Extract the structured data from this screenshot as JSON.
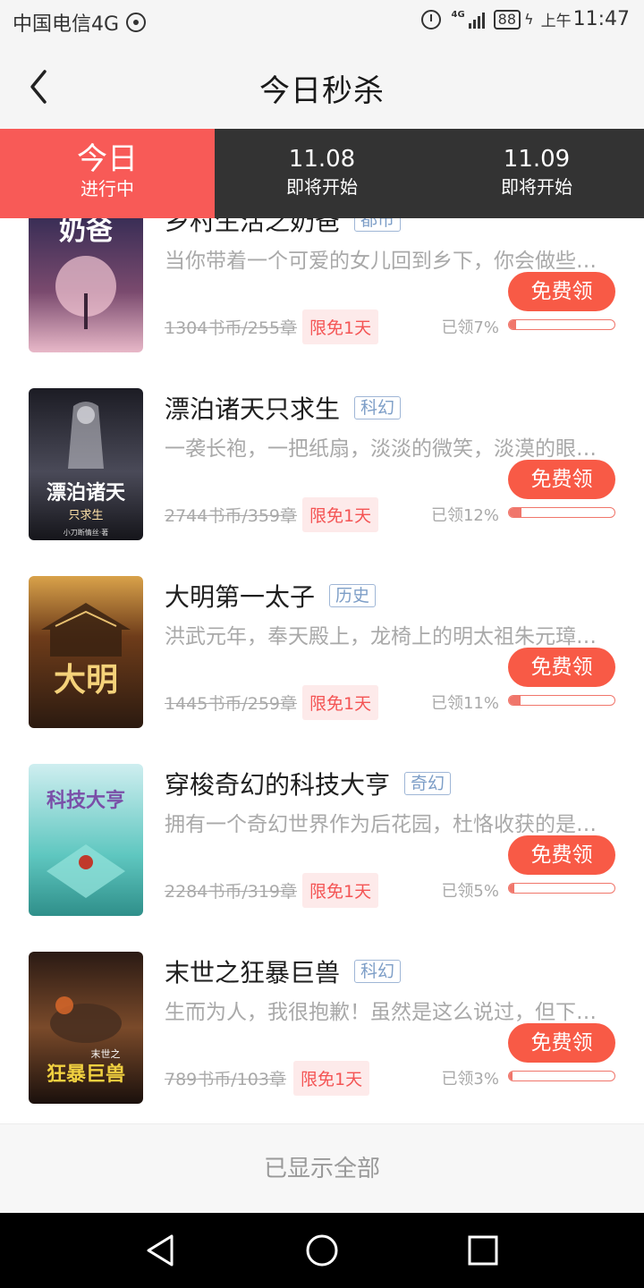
{
  "status_bar": {
    "carrier": "中国电信4G",
    "network": "4G",
    "battery": "88",
    "ampm": "上午",
    "time": "11:47"
  },
  "header": {
    "title": "今日秒杀"
  },
  "tabs": [
    {
      "title": "今日",
      "subtitle": "进行中",
      "active": true
    },
    {
      "title": "11.08",
      "subtitle": "即将开始",
      "active": false
    },
    {
      "title": "11.09",
      "subtitle": "即将开始",
      "active": false
    }
  ],
  "books": [
    {
      "title": "乡村生活之奶爸",
      "genre": "都市",
      "desc": "当你带着一个可爱的女儿回到乡下，你会做些什么呢？",
      "price": "1304书币/255章",
      "tag": "限免1天",
      "button": "免费领",
      "claimed": "已领7%",
      "progress": 0.07
    },
    {
      "title": "漂泊诸天只求生",
      "genre": "科幻",
      "desc": "一袭长袍，一把纸扇，淡淡的微笑，淡漠的眼神……",
      "price": "2744书币/359章",
      "tag": "限免1天",
      "button": "免费领",
      "claimed": "已领12%",
      "progress": 0.12
    },
    {
      "title": "大明第一太子",
      "genre": "历史",
      "desc": "洪武元年，奉天殿上，龙椅上的明太祖朱元璋……",
      "price": "1445书币/259章",
      "tag": "限免1天",
      "button": "免费领",
      "claimed": "已领11%",
      "progress": 0.11
    },
    {
      "title": "穿梭奇幻的科技大亨",
      "genre": "奇幻",
      "desc": "拥有一个奇幻世界作为后花园，杜恪收获的是……",
      "price": "2284书币/319章",
      "tag": "限免1天",
      "button": "免费领",
      "claimed": "已领5%",
      "progress": 0.05
    },
    {
      "title": "末世之狂暴巨兽",
      "genre": "科幻",
      "desc": "生而为人，我很抱歉！虽然是这么说过，但下一秒……",
      "price": "789书币/103章",
      "tag": "限免1天",
      "button": "免费领",
      "claimed": "已领3%",
      "progress": 0.03
    }
  ],
  "covers": [
    {
      "text": "奶爸",
      "colors": [
        "#2a2750",
        "#7a4a6e",
        "#e8b8c8"
      ]
    },
    {
      "text": "漂泊诸天",
      "sub": "只求生",
      "author": "小刀断情丝·著",
      "colors": [
        "#1c1c24",
        "#4a4a58",
        "#c8c8d0"
      ]
    },
    {
      "text": "大明",
      "colors": [
        "#2b1a10",
        "#6e3c1a",
        "#d9a24a"
      ]
    },
    {
      "text": "科技大亨",
      "colors": [
        "#cfeef0",
        "#5fc7c0",
        "#7a4fa8"
      ]
    },
    {
      "text": "狂暴巨兽",
      "sub": "末世之",
      "colors": [
        "#2a1a14",
        "#7a4a2a",
        "#e06a2a"
      ]
    }
  ],
  "footer": {
    "text": "已显示全部"
  }
}
